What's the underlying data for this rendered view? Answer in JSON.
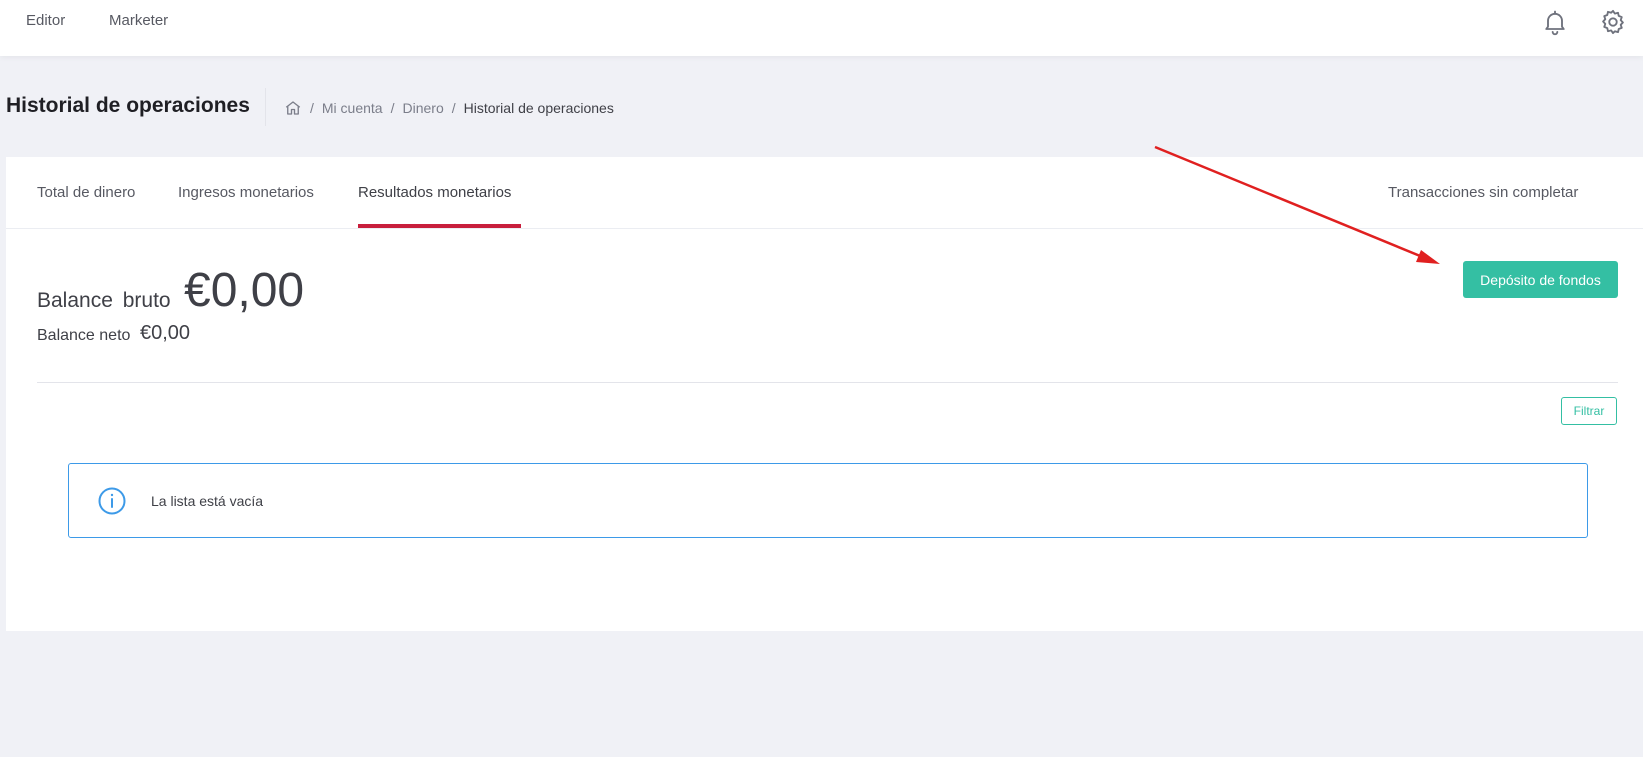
{
  "topnav": {
    "items": [
      "Editor",
      "Marketer"
    ],
    "icons": [
      "bell-icon",
      "gear-icon"
    ]
  },
  "page": {
    "title": "Historial de operaciones",
    "breadcrumb": {
      "home_icon": "home-icon",
      "items": [
        "Mi cuenta",
        "Dinero",
        "Historial de operaciones"
      ],
      "separator": "/"
    }
  },
  "tabs": {
    "items": [
      "Total de dinero",
      "Ingresos monetarios",
      "Resultados monetarios"
    ],
    "active": "Resultados monetarios",
    "right_item": "Transacciones sin completar"
  },
  "balance": {
    "bruto_label": "Balance bruto",
    "bruto_value": "€0,00",
    "neto_label": "Balance neto",
    "neto_value": "€0,00"
  },
  "actions": {
    "deposit_label": "Depósito de fondos",
    "filter_label": "Filtrar"
  },
  "alert": {
    "icon": "info-icon",
    "text": "La lista está vacía"
  },
  "colors": {
    "accent_green": "#34bfa3",
    "tab_active_underline": "#c81e3c",
    "alert_border": "#3d9ae8",
    "annotation_arrow": "#e02020"
  }
}
